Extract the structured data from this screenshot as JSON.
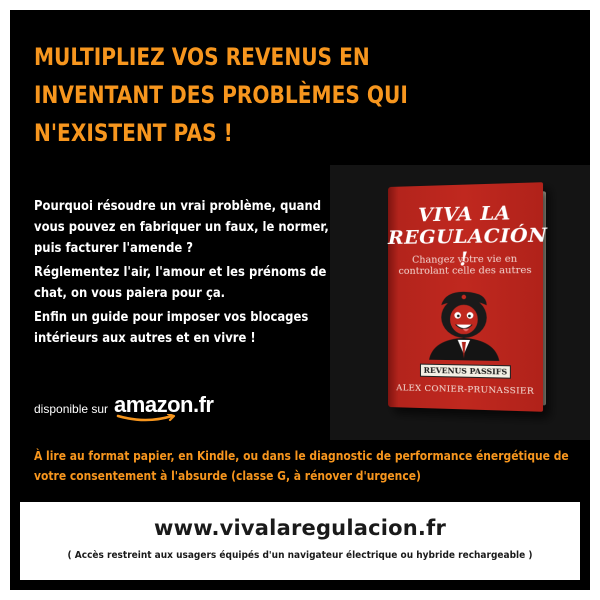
{
  "headline": {
    "line1": "MULTIPLIEZ VOS REVENUS EN",
    "line2": "INVENTANT DES PROBLÈMES QUI",
    "line3": "N'EXISTENT PAS !"
  },
  "paragraphs": {
    "p1": {
      "line1": "Pourquoi résoudre un vrai problème, quand",
      "line2": "vous pouvez en fabriquer un faux, le normer,",
      "line3": "puis facturer l'amende ?"
    },
    "p2": {
      "line1": "Réglementez l'air, l'amour et les prénoms de",
      "line2": "chat, on vous paiera pour ça."
    },
    "p3": {
      "line1": "Enfin un guide pour imposer vos blocages",
      "line2": "intérieurs aux autres et en vivre !"
    }
  },
  "amazon": {
    "available_label": "disponible sur",
    "logo_text": "amazon.fr",
    "logo_smile_color": "#f7961e"
  },
  "book": {
    "title": "VIVA LA\nREGULACIÓN !",
    "subtitle": "Changez votre vie en\ncontrolant celle des autres",
    "badge": "REVENUS PASSIFS",
    "author": "ALEX CONIER-PRUNASSIER",
    "cover_color": "#c0281f",
    "illustration": "caricature-with-beret-icon"
  },
  "formats_note": {
    "line1": "À lire au format papier, en Kindle, ou dans le diagnostic de performance énergétique de",
    "line2": "votre consentement à l'absurde (classe G, à rénover d'urgence)"
  },
  "footer": {
    "url": "www.vivalaregulacion.fr",
    "note": "( Accès restreint aux usagers équipés d'un navigateur électrique ou hybride rechargeable )"
  },
  "colors": {
    "accent_orange": "#f7961e",
    "background": "#000000",
    "text_light": "#ffffff"
  }
}
